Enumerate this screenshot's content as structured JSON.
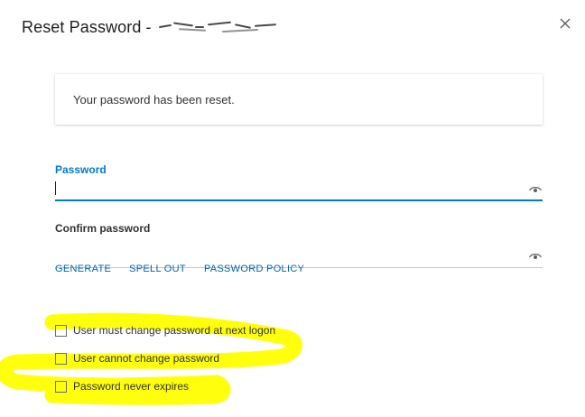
{
  "dialog": {
    "title": "Reset Password - ",
    "redacted_name_icon": "scribbled-out-name",
    "close_icon": "close-x-icon"
  },
  "notice": {
    "text": "Your password has been reset."
  },
  "password_field": {
    "label": "Password",
    "value": "",
    "focused": true,
    "reveal_icon": "eye-icon"
  },
  "confirm_field": {
    "label": "Confirm password",
    "value": "",
    "reveal_icon": "eye-icon"
  },
  "actions": {
    "generate": "GENERATE",
    "spell_out": "SPELL OUT",
    "password_policy": "PASSWORD POLICY"
  },
  "options": [
    {
      "label": "User must change password at next logon",
      "checked": false
    },
    {
      "label": "User cannot change password",
      "checked": false
    },
    {
      "label": "Password never expires",
      "checked": false
    }
  ],
  "colors": {
    "accent": "#0078d4",
    "link": "#0063b1",
    "highlight": "#ffff00"
  }
}
